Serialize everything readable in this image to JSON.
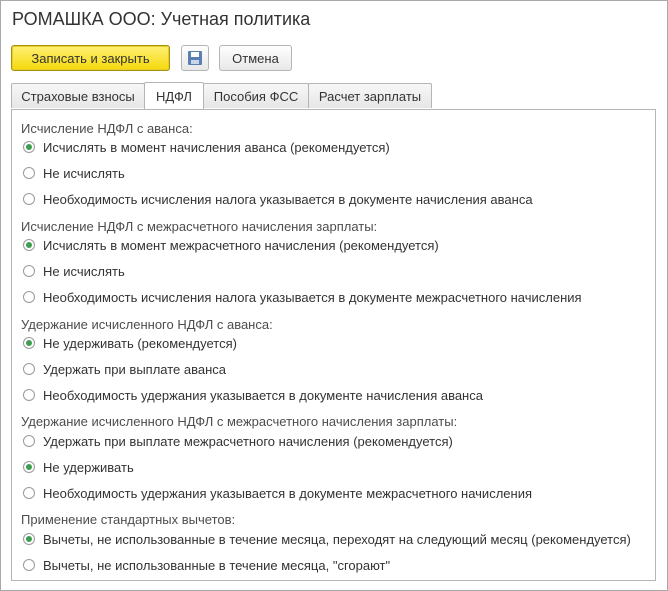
{
  "window": {
    "title": "РОМАШКА ООО: Учетная политика"
  },
  "toolbar": {
    "save_close_label": "Записать и закрыть",
    "save_icon": "floppy-disk-icon",
    "cancel_label": "Отмена"
  },
  "tabs": [
    {
      "label": "Страховые взносы",
      "active": false
    },
    {
      "label": "НДФЛ",
      "active": true
    },
    {
      "label": "Пособия ФСС",
      "active": false
    },
    {
      "label": "Расчет зарплаты",
      "active": false
    }
  ],
  "colors": {
    "accent_button": "#f5d90a",
    "radio_selected": "#3e9e52"
  },
  "groups": [
    {
      "label": "Исчисление НДФЛ с аванса:",
      "options": [
        {
          "label": "Исчислять в момент начисления аванса (рекомендуется)",
          "selected": true
        },
        {
          "label": "Не исчислять",
          "selected": false
        },
        {
          "label": "Необходимость исчисления налога указывается в документе начисления аванса",
          "selected": false
        }
      ]
    },
    {
      "label": "Исчисление НДФЛ с межрасчетного начисления зарплаты:",
      "options": [
        {
          "label": "Исчислять в момент межрасчетного начисления (рекомендуется)",
          "selected": true
        },
        {
          "label": "Не исчислять",
          "selected": false
        },
        {
          "label": "Необходимость исчисления налога указывается в документе межрасчетного начисления",
          "selected": false
        }
      ]
    },
    {
      "label": "Удержание исчисленного НДФЛ с аванса:",
      "options": [
        {
          "label": "Не удерживать (рекомендуется)",
          "selected": true
        },
        {
          "label": "Удержать при выплате аванса",
          "selected": false
        },
        {
          "label": "Необходимость удержания указывается в документе начисления аванса",
          "selected": false
        }
      ]
    },
    {
      "label": "Удержание исчисленного НДФЛ с межрасчетного начисления зарплаты:",
      "options": [
        {
          "label": "Удержать при выплате межрасчетного начисления (рекомендуется)",
          "selected": false
        },
        {
          "label": "Не удерживать",
          "selected": true
        },
        {
          "label": "Необходимость удержания указывается в документе межрасчетного начисления",
          "selected": false
        }
      ]
    },
    {
      "label": "Применение стандартных вычетов:",
      "options": [
        {
          "label": "Вычеты, не использованные в течение месяца, переходят на следующий месяц (рекомендуется)",
          "selected": true
        },
        {
          "label": "Вычеты, не использованные в течение месяца, \"сгорают\"",
          "selected": false
        }
      ]
    }
  ]
}
